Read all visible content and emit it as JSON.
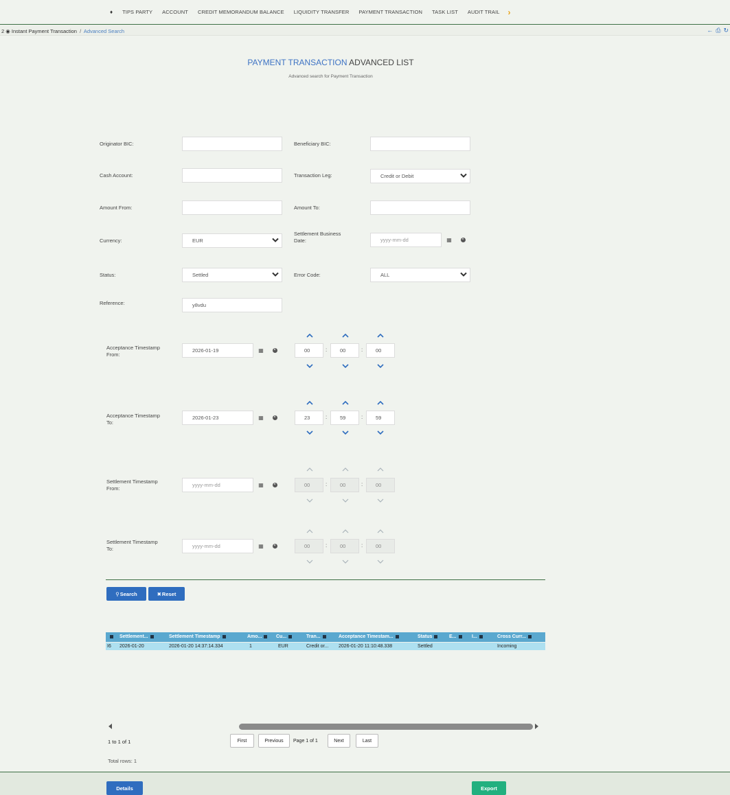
{
  "nav": {
    "items": [
      "TIPS PARTY",
      "ACCOUNT",
      "CREDIT MEMORANDUM BALANCE",
      "LIQUIDITY TRANSFER",
      "PAYMENT TRANSACTION",
      "TASK LIST",
      "AUDIT TRAIL"
    ],
    "home_icon": "home-icon",
    "more_icon": "chevron-right-icon",
    "accent_color": "#e8a317"
  },
  "breadcrumb": {
    "prefix": "2",
    "parent": "Instant Payment Transaction",
    "separator": "/",
    "current": "Advanced Search",
    "icons": [
      "back-arrow-icon",
      "print-icon",
      "refresh-icon"
    ]
  },
  "header": {
    "title_highlight": "PAYMENT TRANSACTION",
    "title_rest": "ADVANCED LIST",
    "subtitle": "Advanced search for Payment Transaction"
  },
  "form": {
    "originator_bic": {
      "label": "Originator BIC:",
      "value": ""
    },
    "beneficiary_bic": {
      "label": "Beneficiary BIC:",
      "value": ""
    },
    "cash_account": {
      "label": "Cash Account:",
      "value": ""
    },
    "transaction_leg": {
      "label": "Transaction Leg:",
      "value": "Credit or Debit"
    },
    "amount_from": {
      "label": "Amount From:",
      "value": ""
    },
    "amount_to": {
      "label": "Amount To:",
      "value": ""
    },
    "currency": {
      "label": "Currency:",
      "value": "EUR"
    },
    "settlement_business_date": {
      "label_line1": "Settlement Business",
      "label_line2": "Date:",
      "placeholder": "yyyy-mm-dd"
    },
    "status": {
      "label": "Status:",
      "value": "Settled"
    },
    "error_code": {
      "label": "Error Code:",
      "value": "ALL"
    },
    "reference": {
      "label": "Reference:",
      "value": "y8vdu"
    },
    "acceptance_from": {
      "label_line1": "Acceptance Timestamp",
      "label_line2": "From:",
      "date": "2026-01-19",
      "hh": "00",
      "mm": "00",
      "ss": "00"
    },
    "acceptance_to": {
      "label_line1": "Acceptance Timestamp",
      "label_line2": "To:",
      "date": "2026-01-23",
      "hh": "23",
      "mm": "59",
      "ss": "59"
    },
    "settlement_from": {
      "label_line1": "Settlement Timestamp",
      "label_line2": "From:",
      "placeholder": "yyyy-mm-dd",
      "hh": "00",
      "mm": "00",
      "ss": "00"
    },
    "settlement_to": {
      "label_line1": "Settlement Timestamp",
      "label_line2": "To:",
      "placeholder": "yyyy-mm-dd",
      "hh": "00",
      "mm": "00",
      "ss": "00"
    },
    "time_colon": ":"
  },
  "actions": {
    "search_label": "Search",
    "reset_label": "Reset",
    "search_icon": "search-icon",
    "reset_icon": "close-icon",
    "primary_color": "#2f6dbf"
  },
  "grid": {
    "columns": [
      "Settlement...",
      "Settlement Timestamp",
      "Amo...",
      "Cu...",
      "Tran...",
      "Acceptance Timestam...",
      "Status",
      "E...",
      "I...",
      "Cross Curr..."
    ],
    "rows": [
      [
        "I6",
        "2026-01-20",
        "2026-01-20 14:37:14.334",
        "1",
        "EUR",
        "Credit or...",
        "2026-01-20 11:10:48.338",
        "Settled",
        "",
        "",
        "Incoming"
      ]
    ],
    "header_color": "#5aa8cf",
    "selected_row_color": "#aee0f0"
  },
  "pager": {
    "info": "1 to 1 of 1",
    "first": "First",
    "previous": "Previous",
    "page_label": "Page 1 of 1",
    "next": "Next",
    "last": "Last",
    "total": "Total rows: 1"
  },
  "footer": {
    "details_label": "Details",
    "export_label": "Export",
    "export_color": "#22b07f"
  }
}
